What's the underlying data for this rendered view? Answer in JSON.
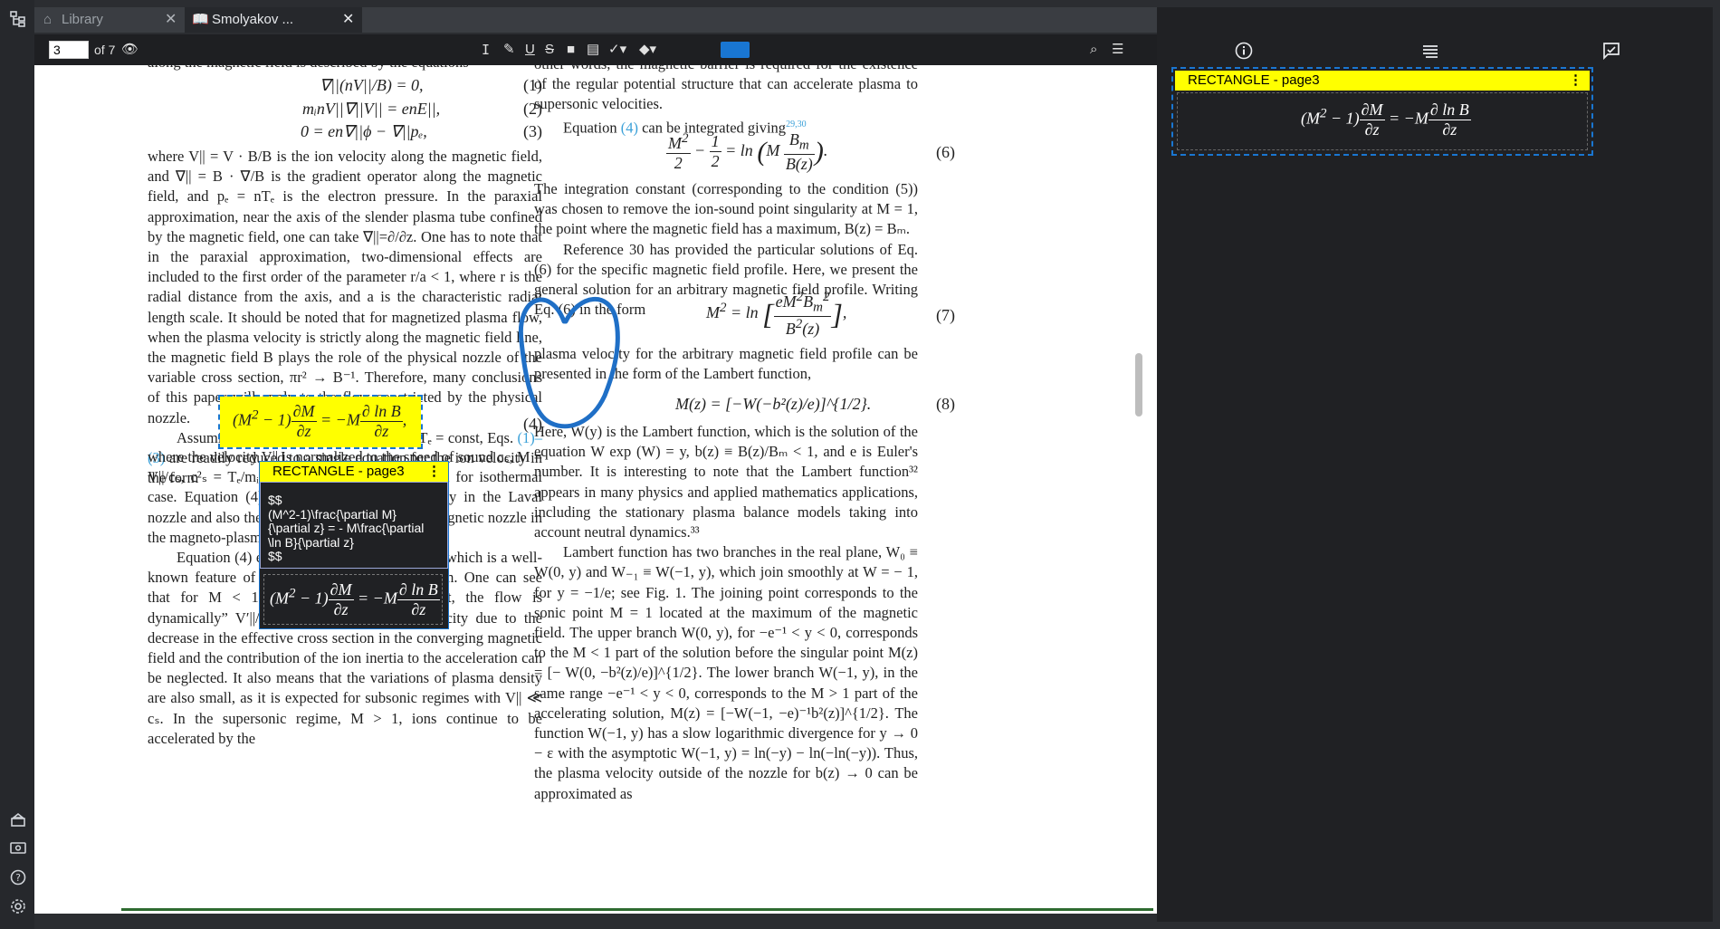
{
  "tabs": [
    {
      "label": "Library",
      "active": false
    },
    {
      "label": "Smolyakov ...",
      "active": true
    }
  ],
  "toolbar": {
    "page_value": "3",
    "page_total": "of 7",
    "accent_color": "#1976d2"
  },
  "icons": [
    "sidebar-tree-icon",
    "home-icon",
    "book-icon",
    "eye-icon",
    "text-cursor-icon",
    "pen-icon",
    "underline-icon",
    "strikethrough-icon",
    "rectangle-icon",
    "note-icon",
    "check-icon",
    "eraser-icon",
    "search-icon",
    "list-icon",
    "info-icon",
    "outline-icon",
    "comment-icon",
    "help-icon",
    "settings-icon",
    "gift-icon",
    "display-icon"
  ],
  "left_col": {
    "top_cut": "along the magnetic field is described by the equations",
    "eq1": "∇||(nV||/B) = 0,",
    "eq1_no": "(1)",
    "eq2": "mᵢnV||∇||V|| = enE||,",
    "eq2_no": "(2)",
    "eq3": "0 = en∇||ϕ − ∇||pₑ,",
    "eq3_no": "(3)",
    "para1": "where V|| = V · B/B is the ion velocity along the magnetic field, and ∇|| = B · ∇/B is the gradient operator along the magnetic field, and pₑ = nTₑ is the electron pressure. In the paraxial approximation, near the axis of the slender plasma tube confined by the magnetic field, one can take ∇||=∂/∂z. One has to note that in the paraxial approximation, two-dimensional effects are included to the first order of the parameter r/a < 1, where r is the radial distance from the axis, and a is the characteristic radial length scale. It should be noted that for magnetized plasma flow, when the plasma velocity is strictly along the magnetic field line, the magnetic field B plays the role of the physical nozzle of the variable cross section, πr² → B⁻¹. Therefore, many conclusions of this paper will apply to the flow constricted by the physical nozzle.",
    "para2a": "Assuming the isothermal electrons with Tₑ = const, Eqs. ",
    "para2ref": "(1)–(3)",
    "para2b": " are readily reduced to a single equation for the ion velocity in the form",
    "eq4_no": "(4)",
    "para3": "where the velocity V|| is normalized to the speed of sound cₛ, M = V||/cₛ, c²ₛ = Tₑ/mᵢ. This is the standard equation for isothermal case. Equation (4) describes the plasma velocity in the Laval nozzle and also the plasma acceleration by the magnetic nozzle in the magneto-plasma-dynamics thrusters.",
    "para4": "Equation (4) exhibits a singularity at M = 1, which is a well-known feature of the quasineutral approximation. One can see that for M < 1, before the ion-sound point, the flow is dynamically” V′||/V|| ≃ B′/B > 0, so the velocity due to the decrease in the effective cross section in the converging magnetic field and the contribution of the ion inertia to the acceleration can be neglected. It also means that the variations of plasma density are also small, as it is expected for subsonic regimes with V|| ≪ cₛ. In the supersonic regime, M > 1, ions continue to be accelerated by the"
  },
  "right_col": {
    "para1": "other words, the magnetic barrier is required for the existence of the regular potential structure that can accelerate plasma to supersonic velocities.",
    "para2a": "Equation ",
    "para2ref": "(4)",
    "para2b": " can be integrated giving",
    "para2sup": "29,30",
    "eq6_no": "(6)",
    "para3": "The integration constant (corresponding to the condition (5)) was chosen to remove the ion-sound point singularity at M = 1, the point where the magnetic field has a maximum, B(z) = Bₘ.",
    "para4": "Reference 30 has provided the particular solutions of Eq. (6) for the specific magnetic field profile. Here, we present the general solution for an arbitrary magnetic field profile. Writing Eq. (6) in the form",
    "eq7_no": "(7)",
    "para5": "plasma velocity for the arbitrary magnetic field profile can be presented in the form of the Lambert function,",
    "eq8": "M(z) = [−W(−b²(z)/e)]^{1/2}.",
    "eq8_no": "(8)",
    "para6": "Here, W(y) is the Lambert function, which is the solution of the equation W exp (W) = y, b(z) ≡ B(z)/Bₘ < 1, and e is Euler's number. It is interesting to note that the Lambert function³² appears in many physics and applied mathematics applications, including the stationary plasma balance models taking into account neutral dynamics.³³",
    "para7": "Lambert function has two branches in the real plane, W₀ ≡ W(0, y) and W₋₁ ≡ W(−1, y), which join smoothly at W = − 1, for y = −1/e; see Fig. 1. The joining point corresponds to the sonic point M = 1 located at the maximum of the magnetic field. The upper branch W(0, y), for −e⁻¹ < y < 0, corresponds to the M < 1 part of the solution before the singular point M(z) = [− W(0, −b²(z)/e)]^{1/2}. The lower branch W(−1, y), in the same range −e⁻¹ < y < 0, corresponds to the M > 1 part of the accelerating solution, M(z) = [−W(−1, −e)⁻¹b²(z)]^{1/2}. The function W(−1, y) has a slow logarithmic divergence for y → 0 − ε with the asymptotic W(−1, y) = ln(−y) − ln(−ln(−y)). Thus, the plasma velocity outside of the nozzle for b(z) → 0 can be approximated as"
  },
  "annotation": {
    "title": "RECTANGLE - page3",
    "latex_lines": [
      "$$",
      "(M^2-1)\\frac{\\partial M}",
      "{\\partial z} = - M\\frac{\\partial",
      "\\ln B}{\\partial z}",
      "$$"
    ],
    "highlight_color": "#ffff00"
  },
  "side_panel": {
    "card_title": "RECTANGLE - page3"
  }
}
